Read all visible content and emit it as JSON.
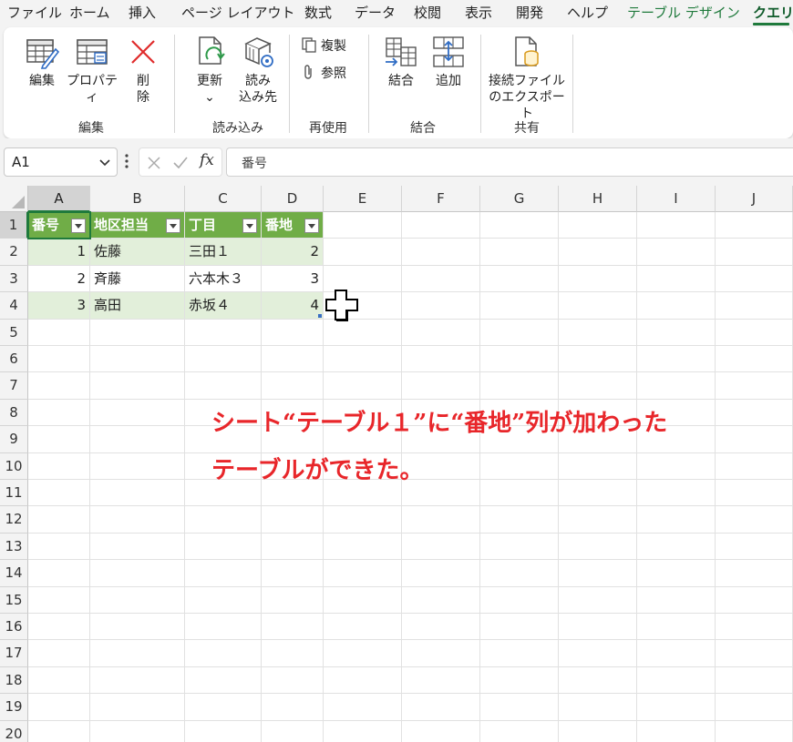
{
  "menu_tabs": [
    "ファイル",
    "ホーム",
    "挿入",
    "ページ レイアウト",
    "数式",
    "データ",
    "校閲",
    "表示",
    "開発",
    "ヘルプ",
    "テーブル デザイン",
    "クエリ"
  ],
  "ribbon": {
    "groups": {
      "edit": {
        "label": "編集",
        "edit_label": "編集",
        "props_label": "プロパティ",
        "delete_label_1": "削",
        "delete_label_2": "除"
      },
      "load": {
        "label": "読み込み",
        "refresh_label": "更新",
        "refresh_arrow": "⌄",
        "loadto_label_1": "読み",
        "loadto_label_2": "込み先"
      },
      "reuse": {
        "label": "再使用",
        "duplicate_label": "複製",
        "reference_label": "参照"
      },
      "combine": {
        "label": "結合",
        "merge_label": "結合",
        "append_label": "追加"
      },
      "share": {
        "label": "共有",
        "export_label_1": "接続ファイル",
        "export_label_2": "のエクスポート"
      }
    }
  },
  "formula_bar": {
    "name_box": "A1",
    "fx": "fx",
    "formula": "番号"
  },
  "columns": [
    "A",
    "B",
    "C",
    "D",
    "E",
    "F",
    "G",
    "H",
    "I",
    "J"
  ],
  "rows": [
    "1",
    "2",
    "3",
    "4",
    "5",
    "6",
    "7",
    "8",
    "9",
    "10",
    "11",
    "12",
    "13",
    "14",
    "15",
    "16",
    "17",
    "18",
    "19",
    "20"
  ],
  "table": {
    "headers": [
      "番号",
      "地区担当",
      "丁目",
      "番地"
    ],
    "rows": [
      [
        "1",
        "佐藤",
        "三田１",
        "2"
      ],
      [
        "2",
        "斉藤",
        "六本木３",
        "3"
      ],
      [
        "3",
        "高田",
        "赤坂４",
        "4"
      ]
    ]
  },
  "annotation": {
    "line1": "シート“テーブル１”に“番地”列が加わった",
    "line2": "テーブルができた。"
  },
  "colors": {
    "table_header": "#70ad47",
    "table_band": "#e2efda",
    "accent_green": "#1f7a3c",
    "annotation_red": "#e8262a"
  }
}
